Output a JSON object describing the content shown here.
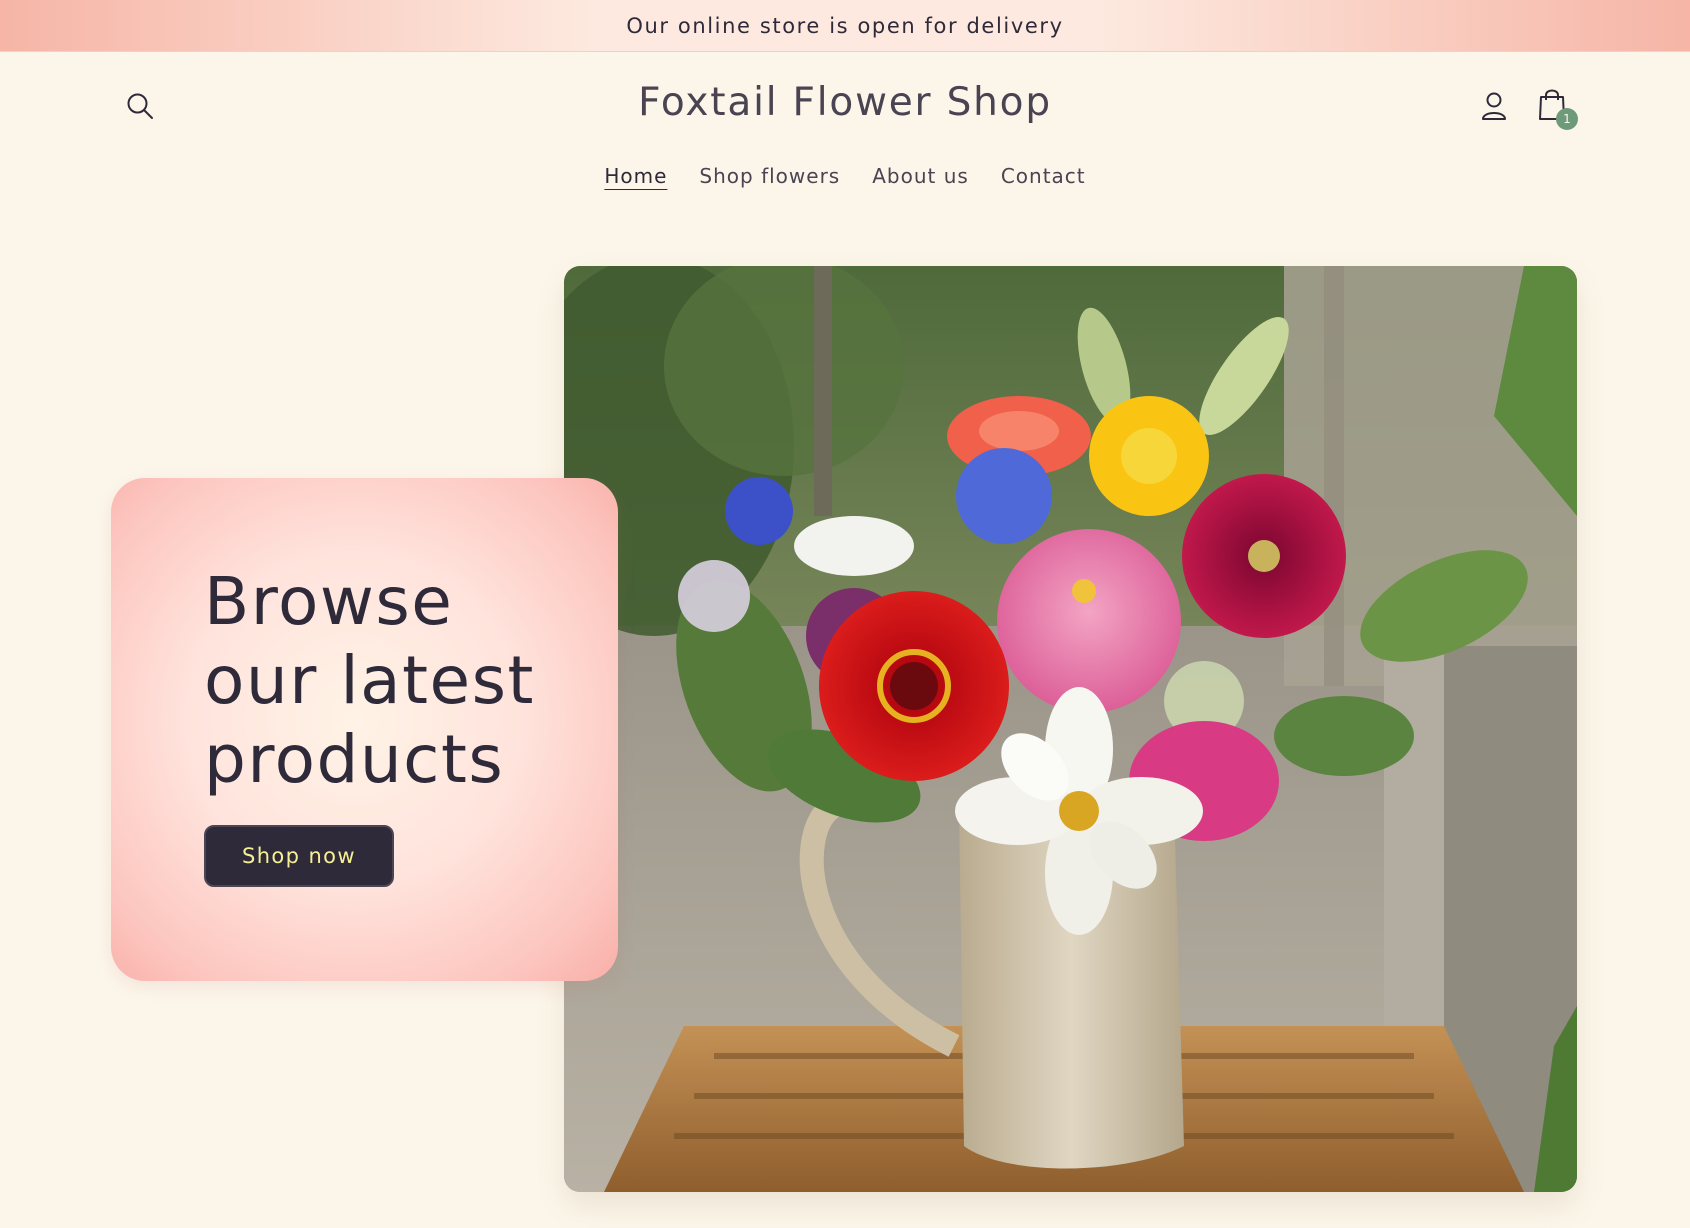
{
  "announcement": {
    "text": "Our online store is open for delivery"
  },
  "header": {
    "shop_title": "Foxtail Flower Shop",
    "cart_count": "1",
    "icons": {
      "search": "search-icon",
      "account": "account-icon",
      "cart": "cart-icon"
    }
  },
  "nav": {
    "items": [
      {
        "label": "Home",
        "active": true
      },
      {
        "label": "Shop flowers",
        "active": false
      },
      {
        "label": "About us",
        "active": false
      },
      {
        "label": "Contact",
        "active": false
      }
    ]
  },
  "hero": {
    "heading_line_1": "Browse",
    "heading_line_2": "our latest",
    "heading_line_3": "products",
    "button_label": "Shop now",
    "image_alt": "Bouquet of zinnias, cornflowers and cosmos in a ceramic pitcher on a bamboo tray"
  },
  "colors": {
    "background": "#fcf6ea",
    "announcement_pink": "#f6b5a6",
    "text_dark": "#2e2a39",
    "button_text": "#f6ef94",
    "cart_badge": "#6f9a7a"
  }
}
